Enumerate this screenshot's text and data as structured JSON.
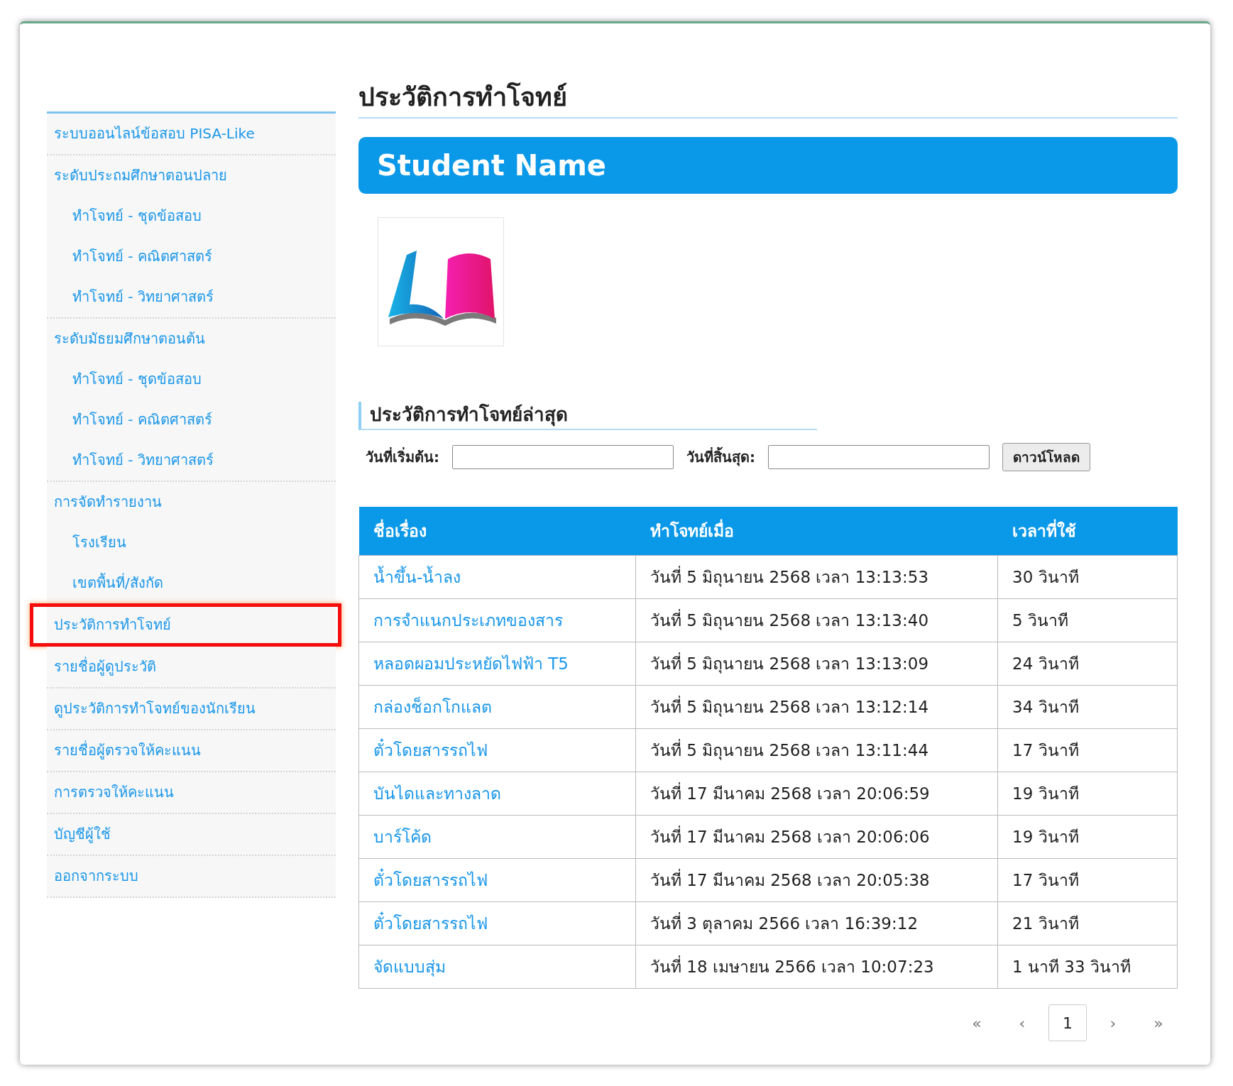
{
  "sidebar": {
    "groups": [
      {
        "label": "ระบบออนไลน์ข้อสอบ PISA-Like",
        "selected": false
      },
      {
        "label": "ระดับประถมศึกษาตอนปลาย",
        "selected": false,
        "children": [
          {
            "label": "ทำโจทย์ - ชุดข้อสอบ",
            "selected": false
          },
          {
            "label": "ทำโจทย์ - คณิตศาสตร์",
            "selected": false
          },
          {
            "label": "ทำโจทย์ - วิทยาศาสตร์",
            "selected": false
          }
        ]
      },
      {
        "label": "ระดับมัธยมศึกษาตอนต้น",
        "selected": false,
        "children": [
          {
            "label": "ทำโจทย์ - ชุดข้อสอบ",
            "selected": false
          },
          {
            "label": "ทำโจทย์ - คณิตศาสตร์",
            "selected": false
          },
          {
            "label": "ทำโจทย์ - วิทยาศาสตร์",
            "selected": false
          }
        ]
      },
      {
        "label": "การจัดทำรายงาน",
        "selected": false,
        "children": [
          {
            "label": "โรงเรียน",
            "selected": false
          },
          {
            "label": "เขตพื้นที่/สังกัด",
            "selected": false
          }
        ]
      },
      {
        "label": "ประวัติการทำโจทย์",
        "selected": true
      },
      {
        "label": "รายชื่อผู้ดูประวัติ",
        "selected": false
      },
      {
        "label": "ดูประวัติการทำโจทย์ของนักเรียน",
        "selected": false
      },
      {
        "label": "รายชื่อผู้ตรวจให้คะแนน",
        "selected": false
      },
      {
        "label": "การตรวจให้คะแนน",
        "selected": false
      },
      {
        "label": "บัญชีผู้ใช้",
        "selected": false
      },
      {
        "label": "ออกจากระบบ",
        "selected": false
      }
    ]
  },
  "page_title": "ประวัติการทำโจทย์",
  "banner": "Student Name",
  "section_title": "ประวัติการทำโจทย์ล่าสุด",
  "filter": {
    "start_label": "วันที่เริ่มต้น:",
    "end_label": "วันที่สิ้นสุด:",
    "button": "ดาวน์โหลด"
  },
  "table": {
    "columns": [
      "ชื่อเรื่อง",
      "ทำโจทย์เมื่อ",
      "เวลาที่ใช้"
    ],
    "rows": [
      [
        "น้ำขึ้น-น้ำลง",
        "วันที่ 5 มิถุนายน 2568 เวลา 13:13:53",
        "30 วินาที"
      ],
      [
        "การจำแนกประเภทของสาร",
        "วันที่ 5 มิถุนายน 2568 เวลา 13:13:40",
        "5 วินาที"
      ],
      [
        "หลอดผอมประหยัดไฟฟ้า T5",
        "วันที่ 5 มิถุนายน 2568 เวลา 13:13:09",
        "24 วินาที"
      ],
      [
        "กล่องช็อกโกแลต",
        "วันที่ 5 มิถุนายน 2568 เวลา 13:12:14",
        "34 วินาที"
      ],
      [
        "ตั๋วโดยสารรถไฟ",
        "วันที่ 5 มิถุนายน 2568 เวลา 13:11:44",
        "17 วินาที"
      ],
      [
        "บันไดและทางลาด",
        "วันที่ 17 มีนาคม 2568 เวลา 20:06:59",
        "19 วินาที"
      ],
      [
        "บาร์โค้ด",
        "วันที่ 17 มีนาคม 2568 เวลา 20:06:06",
        "19 วินาที"
      ],
      [
        "ตั๋วโดยสารรถไฟ",
        "วันที่ 17 มีนาคม 2568 เวลา 20:05:38",
        "17 วินาที"
      ],
      [
        "ตั๋วโดยสารรถไฟ",
        "วันที่ 3 ตุลาคม 2566 เวลา 16:39:12",
        "21 วินาที"
      ],
      [
        "จัดแบบสุ่ม",
        "วันที่ 18 เมษายน 2566 เวลา 10:07:23",
        "1 นาที 33 วินาที"
      ]
    ]
  },
  "pagination": [
    {
      "label": "«",
      "selected": false
    },
    {
      "label": "‹",
      "selected": false
    },
    {
      "label": "1",
      "selected": true
    },
    {
      "label": "›",
      "selected": false
    },
    {
      "label": "»",
      "selected": false
    }
  ]
}
